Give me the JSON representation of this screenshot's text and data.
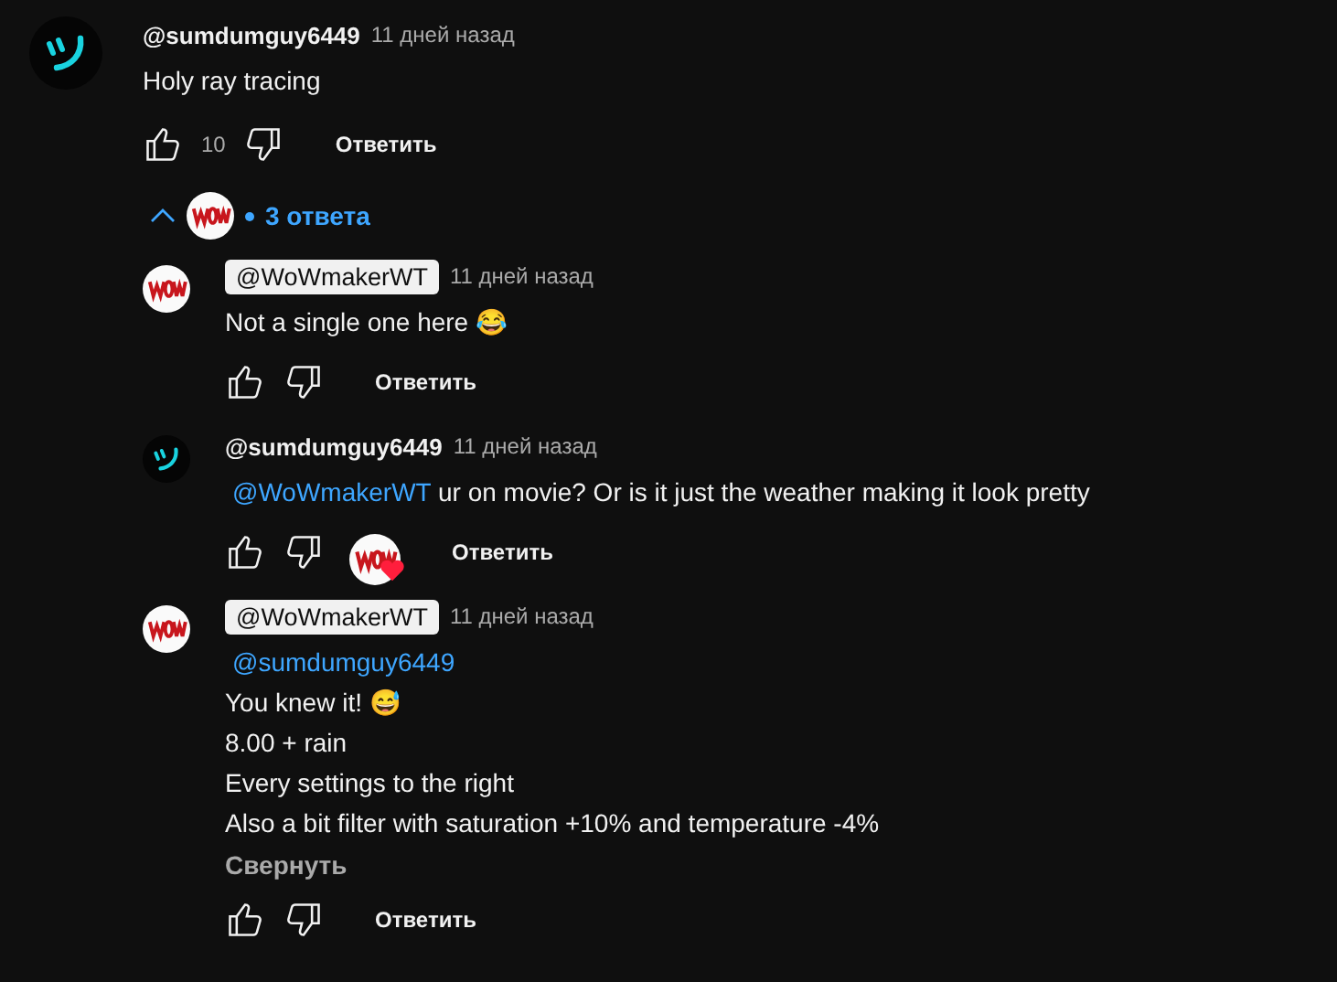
{
  "comment": {
    "avatar": {
      "kind": "smiley"
    },
    "author": "@sumdumguy6449",
    "author_highlighted": false,
    "time": "11 дней назад",
    "lines": [
      {
        "text": "Holy ray tracing"
      }
    ],
    "likes": "10",
    "creator_heart": false,
    "reply_label": "Ответить"
  },
  "replies_toggle": {
    "expanded": true,
    "avatar": {
      "kind": "wow"
    },
    "count": "3 ответа"
  },
  "replies": [
    {
      "avatar": {
        "kind": "wow"
      },
      "author": "@WoWmakerWT",
      "author_highlighted": true,
      "time": "11 дней назад",
      "lines": [
        {
          "text": "Not a single one here 😂"
        }
      ],
      "creator_heart": false,
      "reply_label": "Ответить"
    },
    {
      "avatar": {
        "kind": "smiley"
      },
      "author": "@sumdumguy6449",
      "author_highlighted": false,
      "time": "11 дней назад",
      "lines": [
        {
          "mention": "@WoWmakerWT",
          "text": "ur on movie? Or is it just the weather making it look pretty"
        }
      ],
      "creator_heart": true,
      "reply_label": "Ответить"
    },
    {
      "avatar": {
        "kind": "wow"
      },
      "author": "@WoWmakerWT",
      "author_highlighted": true,
      "time": "11 дней назад",
      "lines": [
        {
          "mention": "@sumdumguy6449"
        },
        {
          "text": "You knew it! 😅"
        },
        {
          "text": "8.00 + rain"
        },
        {
          "text": "Every settings to the right"
        },
        {
          "text": "Also a bit filter with saturation +10% and temperature -4%"
        }
      ],
      "collapse_label": "Свернуть",
      "creator_heart": false,
      "reply_label": "Ответить"
    }
  ]
}
